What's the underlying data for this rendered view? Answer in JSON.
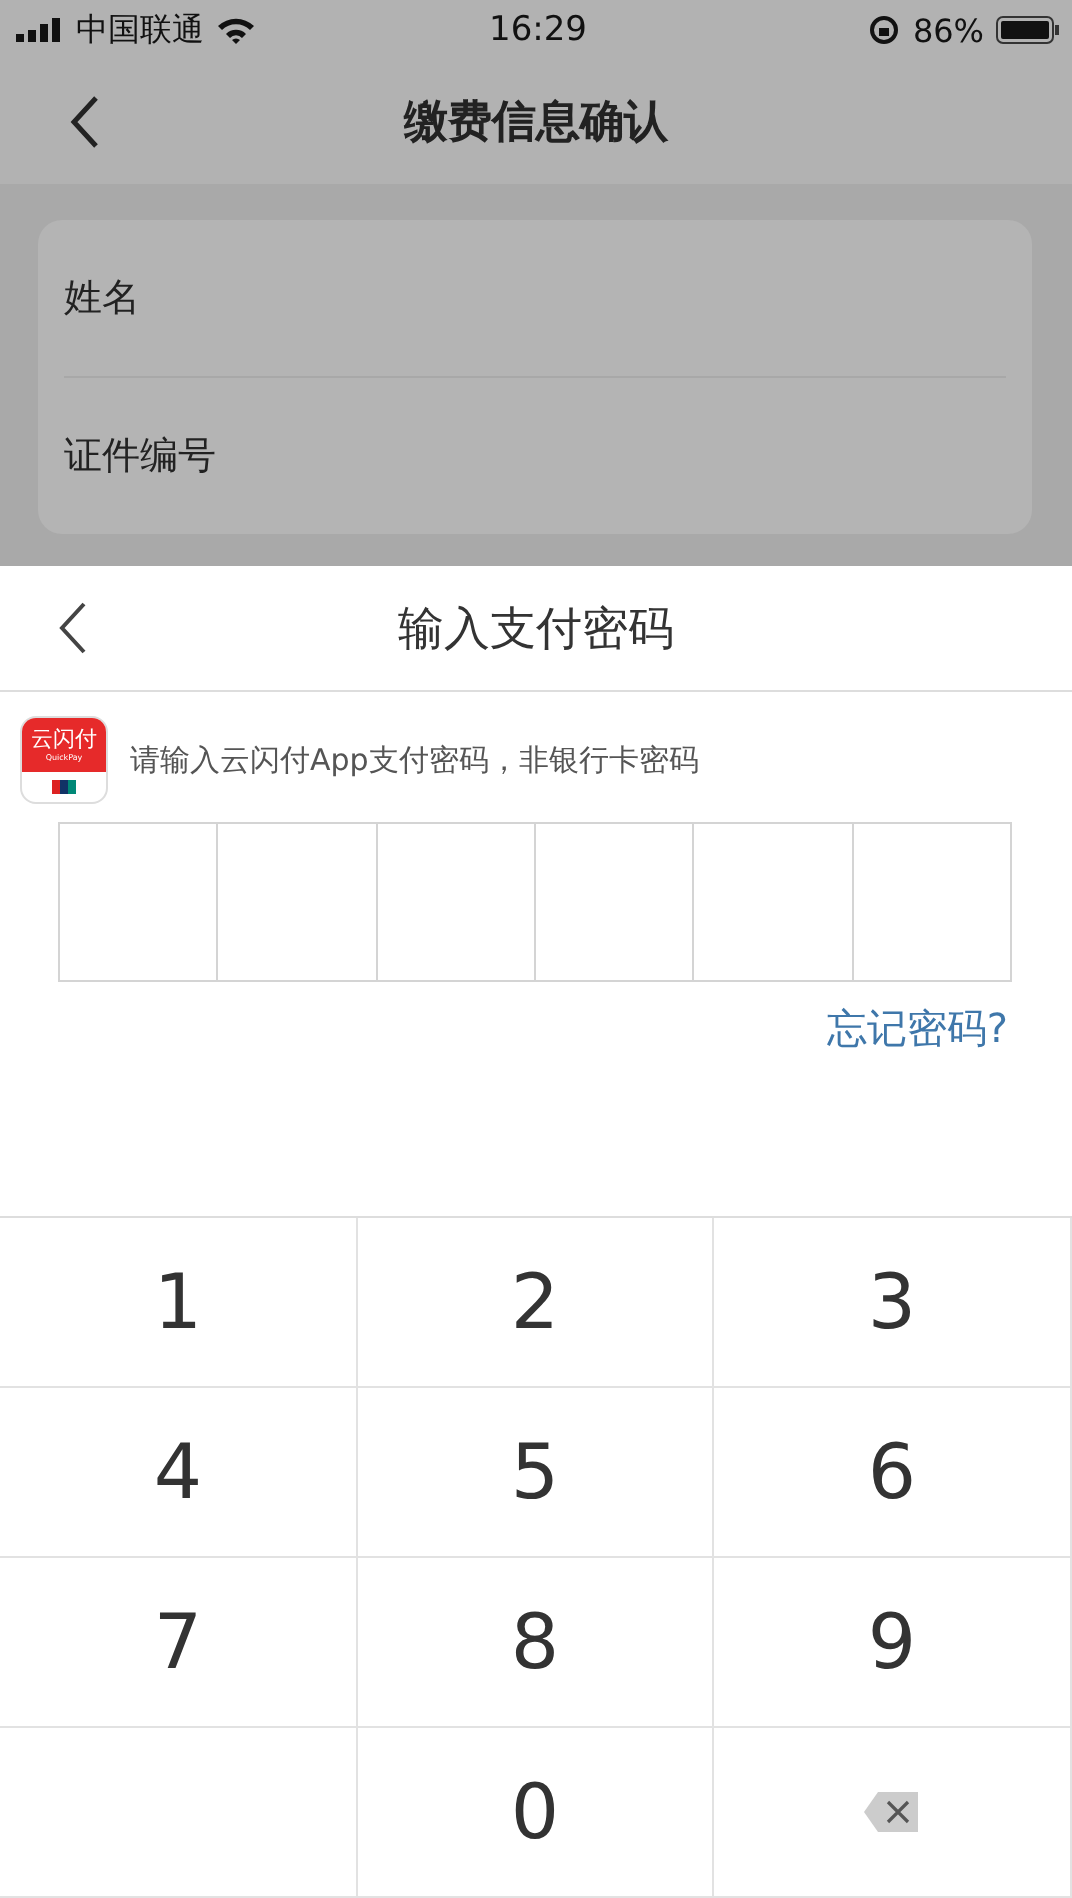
{
  "status_bar": {
    "carrier": "中国联通",
    "time": "16:29",
    "battery": "86%"
  },
  "nav": {
    "title": "缴费信息确认"
  },
  "form": {
    "fields": [
      {
        "label": "姓名"
      },
      {
        "label": "证件编号"
      }
    ]
  },
  "sheet": {
    "title": "输入支付密码",
    "app_logo": {
      "name": "云闪付",
      "subtitle": "QuickPay"
    },
    "hint": "请输入云闪付App支付密码，非银行卡密码",
    "password_cells": [
      {
        "filled": false
      },
      {
        "filled": false
      },
      {
        "filled": false
      },
      {
        "filled": false
      },
      {
        "filled": false
      },
      {
        "filled": false
      }
    ],
    "forgot_link": "忘记密码?"
  },
  "keypad": [
    {
      "kind": "digit",
      "label": "1"
    },
    {
      "kind": "digit",
      "label": "2"
    },
    {
      "kind": "digit",
      "label": "3"
    },
    {
      "kind": "digit",
      "label": "4"
    },
    {
      "kind": "digit",
      "label": "5"
    },
    {
      "kind": "digit",
      "label": "6"
    },
    {
      "kind": "digit",
      "label": "7"
    },
    {
      "kind": "digit",
      "label": "8"
    },
    {
      "kind": "digit",
      "label": "9"
    },
    {
      "kind": "blank"
    },
    {
      "kind": "digit",
      "label": "0"
    },
    {
      "kind": "backspace"
    }
  ]
}
